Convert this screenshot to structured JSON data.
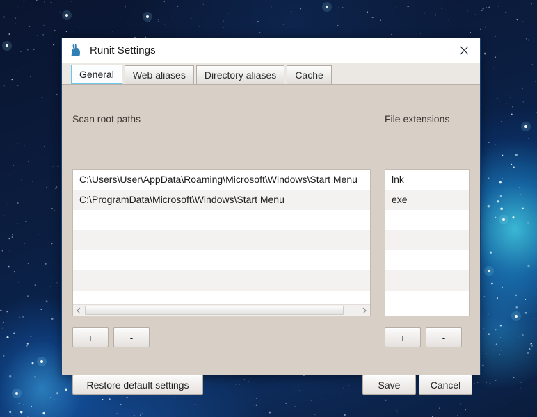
{
  "window": {
    "title": "Runit Settings",
    "icon": "rabbit-icon",
    "close_label": "×"
  },
  "tabs": [
    {
      "label": "General",
      "selected": true
    },
    {
      "label": "Web aliases",
      "selected": false
    },
    {
      "label": "Directory aliases",
      "selected": false
    },
    {
      "label": "Cache",
      "selected": false
    }
  ],
  "scan_root_paths": {
    "label": "Scan root paths",
    "items": [
      "C:\\Users\\User\\AppData\\Roaming\\Microsoft\\Windows\\Start Menu",
      "C:\\ProgramData\\Microsoft\\Windows\\Start Menu"
    ],
    "visible_rows": 7,
    "add_label": "+",
    "remove_label": "-",
    "scrollbar": {
      "left_arrow": "‹",
      "right_arrow": "›",
      "orientation": "horizontal"
    }
  },
  "file_extensions": {
    "label": "File extensions",
    "items": [
      "lnk",
      "exe"
    ],
    "visible_rows": 7,
    "add_label": "+",
    "remove_label": "-"
  },
  "footer": {
    "restore_label": "Restore default settings",
    "save_label": "Save",
    "cancel_label": "Cancel"
  },
  "colors": {
    "dialog_bg": "#d8cfc7",
    "titlebar_bg": "#ffffff",
    "selected_tab_border": "#6fc5e8",
    "window_border": "#17407a",
    "icon_blue": "#2f7fb5"
  }
}
